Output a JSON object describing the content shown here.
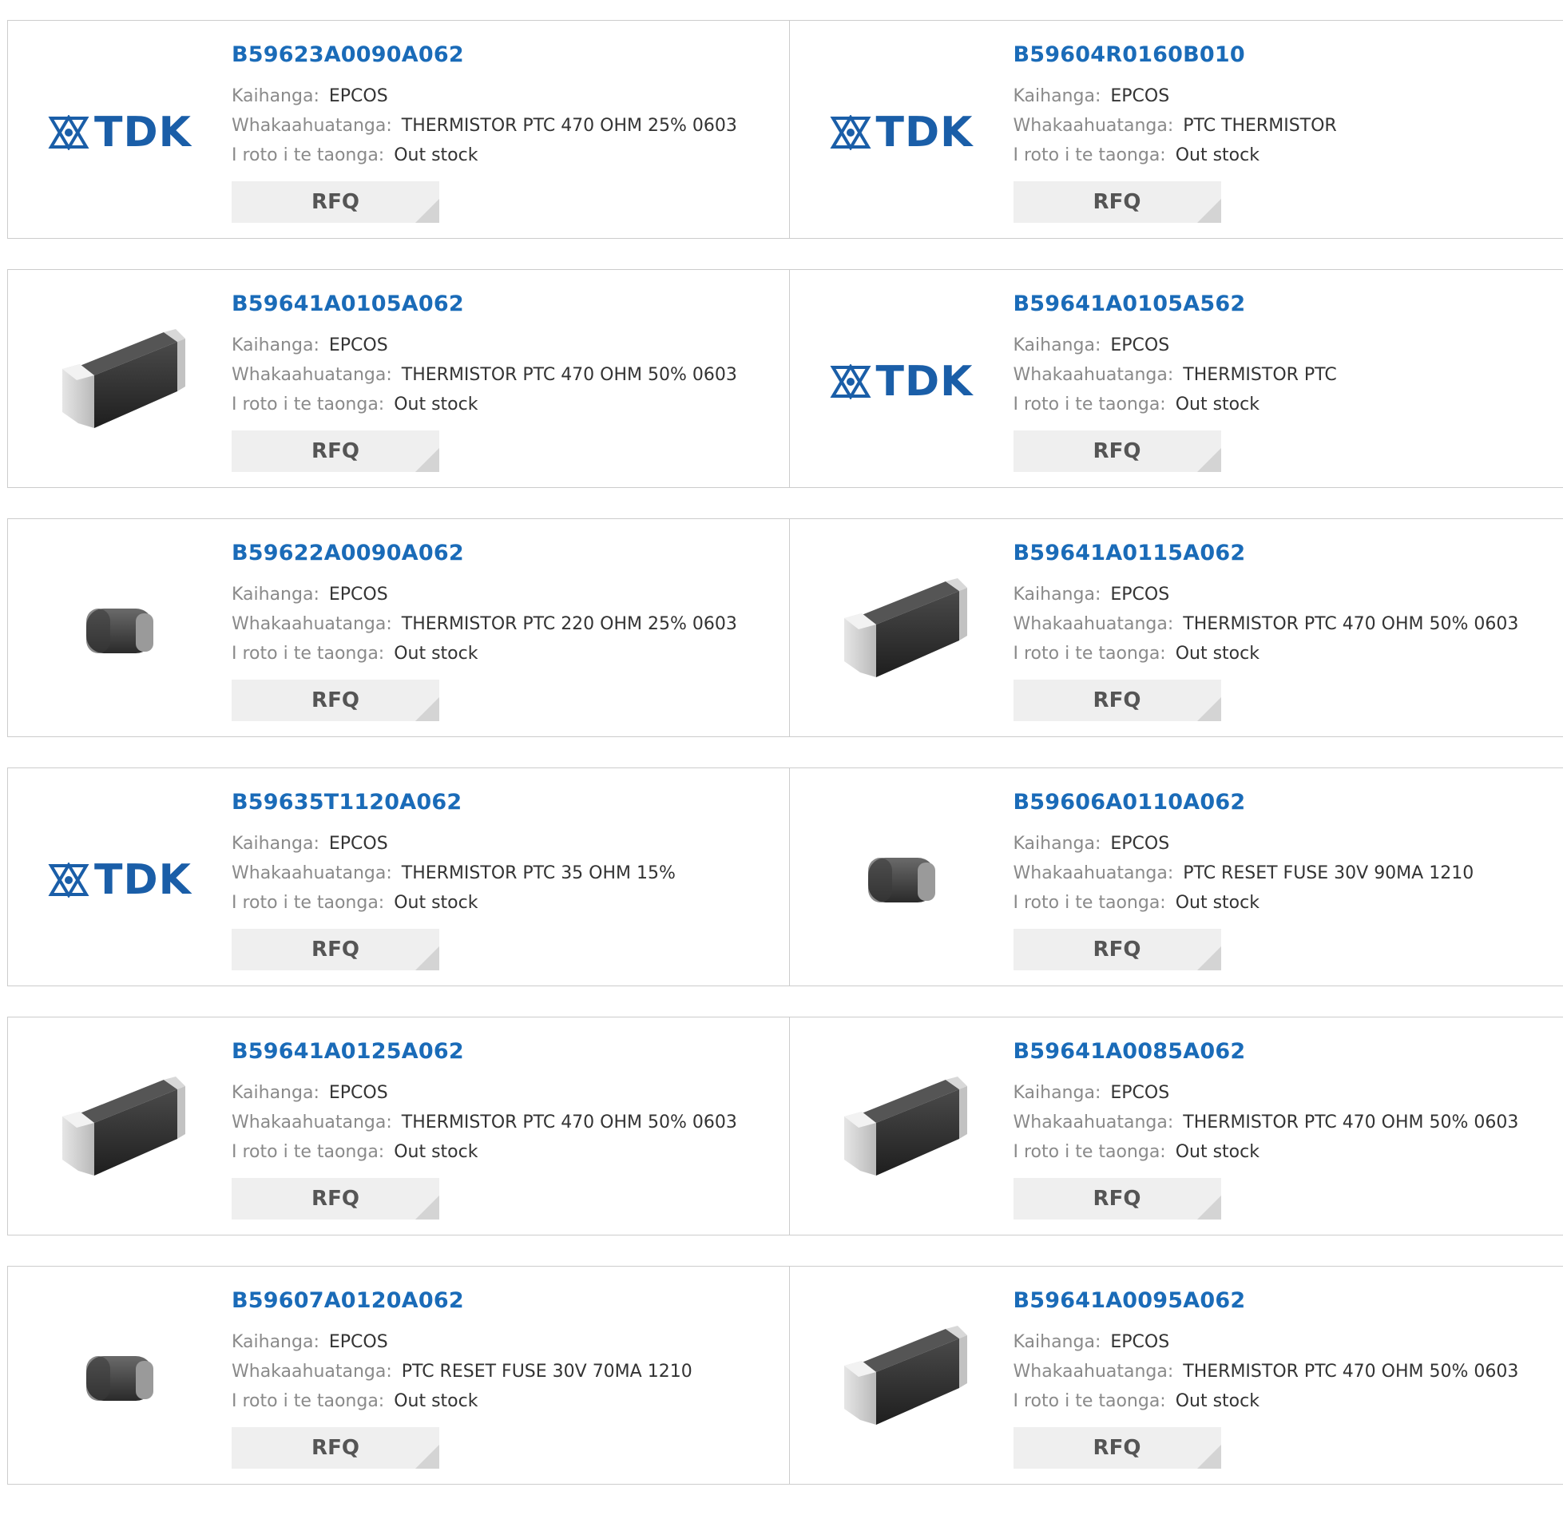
{
  "labels": {
    "manufacturer": "Kaihanga:",
    "description": "Whakaahuatanga:",
    "stock": "I roto i te taonga:",
    "rfq": "RFQ"
  },
  "logo_text": "TDK",
  "colors": {
    "link": "#1a6bb8",
    "tdk_blue": "#1a5ea8",
    "button_bg": "#efefef"
  },
  "products": [
    {
      "part": "B59623A0090A062",
      "manufacturer": "EPCOS",
      "description": "THERMISTOR PTC 470 OHM 25% 0603",
      "stock": "Out stock",
      "image": "tdk-logo"
    },
    {
      "part": "B59604R0160B010",
      "manufacturer": "EPCOS",
      "description": "PTC THERMISTOR",
      "stock": "Out stock",
      "image": "tdk-logo"
    },
    {
      "part": "B59641A0105A062",
      "manufacturer": "EPCOS",
      "description": "THERMISTOR PTC 470 OHM 50% 0603",
      "stock": "Out stock",
      "image": "smd-chip-long"
    },
    {
      "part": "B59641A0105A562",
      "manufacturer": "EPCOS",
      "description": "THERMISTOR PTC",
      "stock": "Out stock",
      "image": "tdk-logo"
    },
    {
      "part": "B59622A0090A062",
      "manufacturer": "EPCOS",
      "description": "THERMISTOR PTC 220 OHM 25% 0603",
      "stock": "Out stock",
      "image": "smd-chip-small"
    },
    {
      "part": "B59641A0115A062",
      "manufacturer": "EPCOS",
      "description": "THERMISTOR PTC 470 OHM 50% 0603",
      "stock": "Out stock",
      "image": "smd-chip-long"
    },
    {
      "part": "B59635T1120A062",
      "manufacturer": "EPCOS",
      "description": "THERMISTOR PTC 35 OHM 15%",
      "stock": "Out stock",
      "image": "tdk-logo"
    },
    {
      "part": "B59606A0110A062",
      "manufacturer": "EPCOS",
      "description": "PTC RESET FUSE 30V 90MA 1210",
      "stock": "Out stock",
      "image": "smd-chip-small"
    },
    {
      "part": "B59641A0125A062",
      "manufacturer": "EPCOS",
      "description": "THERMISTOR PTC 470 OHM 50% 0603",
      "stock": "Out stock",
      "image": "smd-chip-long"
    },
    {
      "part": "B59641A0085A062",
      "manufacturer": "EPCOS",
      "description": "THERMISTOR PTC 470 OHM 50% 0603",
      "stock": "Out stock",
      "image": "smd-chip-long"
    },
    {
      "part": "B59607A0120A062",
      "manufacturer": "EPCOS",
      "description": "PTC RESET FUSE 30V 70MA 1210",
      "stock": "Out stock",
      "image": "smd-chip-small"
    },
    {
      "part": "B59641A0095A062",
      "manufacturer": "EPCOS",
      "description": "THERMISTOR PTC 470 OHM 50% 0603",
      "stock": "Out stock",
      "image": "smd-chip-long"
    }
  ]
}
